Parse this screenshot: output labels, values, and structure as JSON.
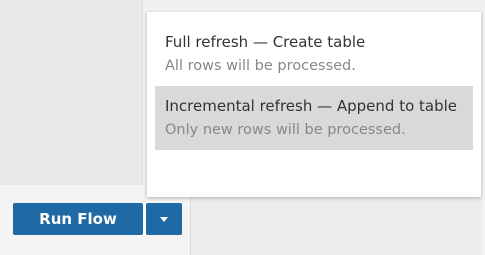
{
  "menu": {
    "options": [
      {
        "title": "Full refresh — Create table",
        "description": "All rows will be processed.",
        "selected": false
      },
      {
        "title": "Incremental refresh — Append to table",
        "description": "Only new rows will be processed.",
        "selected": true
      }
    ]
  },
  "toolbar": {
    "run_flow_label": "Run Flow",
    "dropdown_icon": "chevron-down-icon"
  },
  "colors": {
    "accent": "#1f6aa5",
    "selected_bg": "#d9d9d9",
    "secondary_text": "#888888"
  }
}
